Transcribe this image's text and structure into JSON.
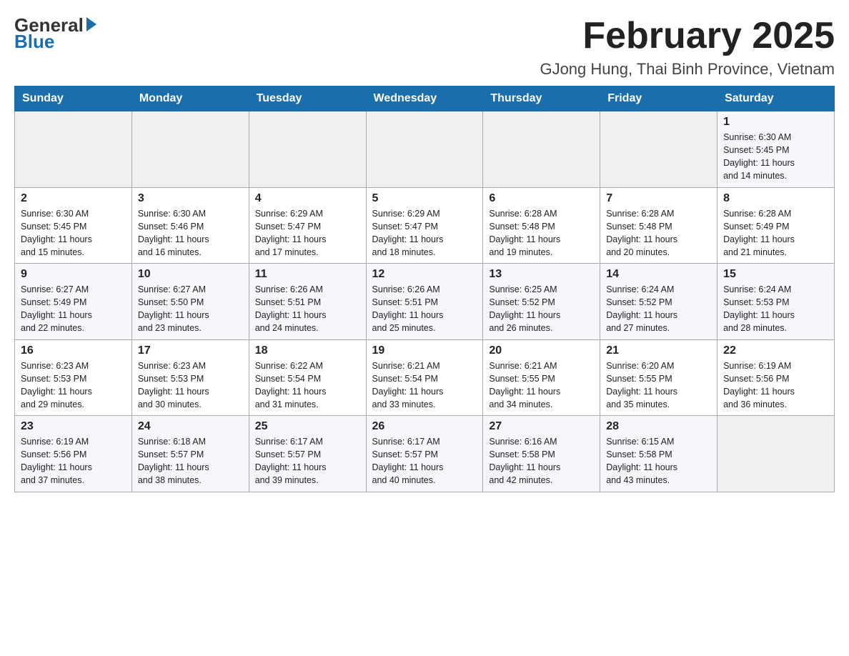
{
  "header": {
    "logo_general": "General",
    "logo_blue": "Blue",
    "month_title": "February 2025",
    "location": "GJong Hung, Thai Binh Province, Vietnam"
  },
  "days_of_week": [
    "Sunday",
    "Monday",
    "Tuesday",
    "Wednesday",
    "Thursday",
    "Friday",
    "Saturday"
  ],
  "weeks": [
    {
      "days": [
        {
          "number": "",
          "info": ""
        },
        {
          "number": "",
          "info": ""
        },
        {
          "number": "",
          "info": ""
        },
        {
          "number": "",
          "info": ""
        },
        {
          "number": "",
          "info": ""
        },
        {
          "number": "",
          "info": ""
        },
        {
          "number": "1",
          "info": "Sunrise: 6:30 AM\nSunset: 5:45 PM\nDaylight: 11 hours\nand 14 minutes."
        }
      ]
    },
    {
      "days": [
        {
          "number": "2",
          "info": "Sunrise: 6:30 AM\nSunset: 5:45 PM\nDaylight: 11 hours\nand 15 minutes."
        },
        {
          "number": "3",
          "info": "Sunrise: 6:30 AM\nSunset: 5:46 PM\nDaylight: 11 hours\nand 16 minutes."
        },
        {
          "number": "4",
          "info": "Sunrise: 6:29 AM\nSunset: 5:47 PM\nDaylight: 11 hours\nand 17 minutes."
        },
        {
          "number": "5",
          "info": "Sunrise: 6:29 AM\nSunset: 5:47 PM\nDaylight: 11 hours\nand 18 minutes."
        },
        {
          "number": "6",
          "info": "Sunrise: 6:28 AM\nSunset: 5:48 PM\nDaylight: 11 hours\nand 19 minutes."
        },
        {
          "number": "7",
          "info": "Sunrise: 6:28 AM\nSunset: 5:48 PM\nDaylight: 11 hours\nand 20 minutes."
        },
        {
          "number": "8",
          "info": "Sunrise: 6:28 AM\nSunset: 5:49 PM\nDaylight: 11 hours\nand 21 minutes."
        }
      ]
    },
    {
      "days": [
        {
          "number": "9",
          "info": "Sunrise: 6:27 AM\nSunset: 5:49 PM\nDaylight: 11 hours\nand 22 minutes."
        },
        {
          "number": "10",
          "info": "Sunrise: 6:27 AM\nSunset: 5:50 PM\nDaylight: 11 hours\nand 23 minutes."
        },
        {
          "number": "11",
          "info": "Sunrise: 6:26 AM\nSunset: 5:51 PM\nDaylight: 11 hours\nand 24 minutes."
        },
        {
          "number": "12",
          "info": "Sunrise: 6:26 AM\nSunset: 5:51 PM\nDaylight: 11 hours\nand 25 minutes."
        },
        {
          "number": "13",
          "info": "Sunrise: 6:25 AM\nSunset: 5:52 PM\nDaylight: 11 hours\nand 26 minutes."
        },
        {
          "number": "14",
          "info": "Sunrise: 6:24 AM\nSunset: 5:52 PM\nDaylight: 11 hours\nand 27 minutes."
        },
        {
          "number": "15",
          "info": "Sunrise: 6:24 AM\nSunset: 5:53 PM\nDaylight: 11 hours\nand 28 minutes."
        }
      ]
    },
    {
      "days": [
        {
          "number": "16",
          "info": "Sunrise: 6:23 AM\nSunset: 5:53 PM\nDaylight: 11 hours\nand 29 minutes."
        },
        {
          "number": "17",
          "info": "Sunrise: 6:23 AM\nSunset: 5:53 PM\nDaylight: 11 hours\nand 30 minutes."
        },
        {
          "number": "18",
          "info": "Sunrise: 6:22 AM\nSunset: 5:54 PM\nDaylight: 11 hours\nand 31 minutes."
        },
        {
          "number": "19",
          "info": "Sunrise: 6:21 AM\nSunset: 5:54 PM\nDaylight: 11 hours\nand 33 minutes."
        },
        {
          "number": "20",
          "info": "Sunrise: 6:21 AM\nSunset: 5:55 PM\nDaylight: 11 hours\nand 34 minutes."
        },
        {
          "number": "21",
          "info": "Sunrise: 6:20 AM\nSunset: 5:55 PM\nDaylight: 11 hours\nand 35 minutes."
        },
        {
          "number": "22",
          "info": "Sunrise: 6:19 AM\nSunset: 5:56 PM\nDaylight: 11 hours\nand 36 minutes."
        }
      ]
    },
    {
      "days": [
        {
          "number": "23",
          "info": "Sunrise: 6:19 AM\nSunset: 5:56 PM\nDaylight: 11 hours\nand 37 minutes."
        },
        {
          "number": "24",
          "info": "Sunrise: 6:18 AM\nSunset: 5:57 PM\nDaylight: 11 hours\nand 38 minutes."
        },
        {
          "number": "25",
          "info": "Sunrise: 6:17 AM\nSunset: 5:57 PM\nDaylight: 11 hours\nand 39 minutes."
        },
        {
          "number": "26",
          "info": "Sunrise: 6:17 AM\nSunset: 5:57 PM\nDaylight: 11 hours\nand 40 minutes."
        },
        {
          "number": "27",
          "info": "Sunrise: 6:16 AM\nSunset: 5:58 PM\nDaylight: 11 hours\nand 42 minutes."
        },
        {
          "number": "28",
          "info": "Sunrise: 6:15 AM\nSunset: 5:58 PM\nDaylight: 11 hours\nand 43 minutes."
        },
        {
          "number": "",
          "info": ""
        }
      ]
    }
  ]
}
